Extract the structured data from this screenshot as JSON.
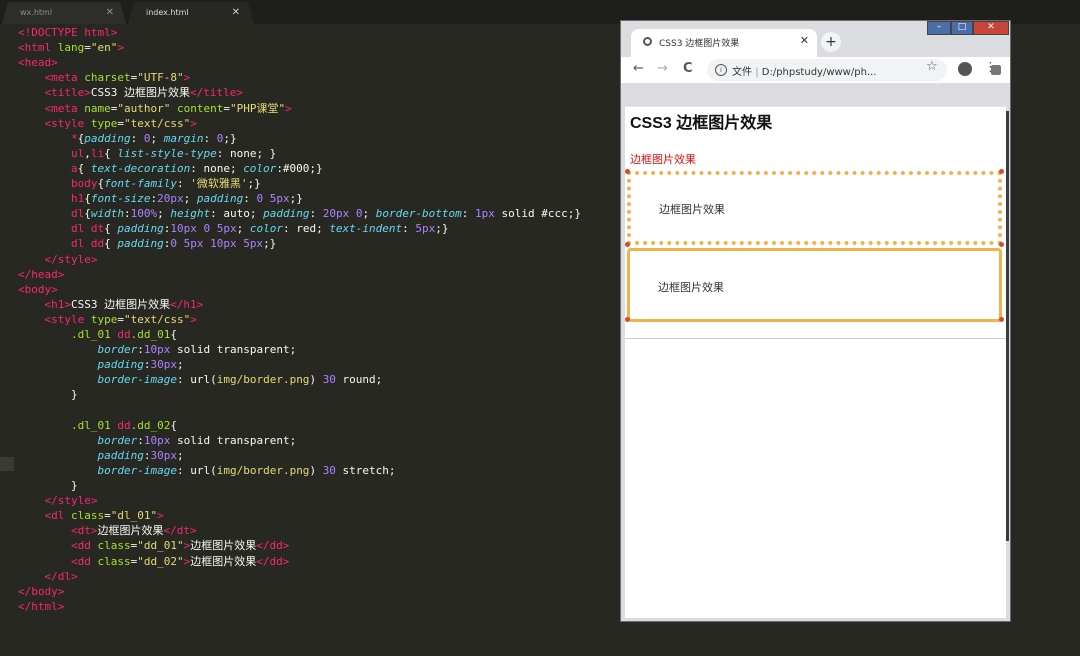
{
  "editor": {
    "tabs": [
      {
        "label": "wx.html",
        "close": "✕"
      },
      {
        "label": "index.html",
        "close": "✕"
      }
    ],
    "lines": [
      [
        "t:<!DOCTYPE html>"
      ],
      [
        "t:<html ",
        "a:lang",
        "w:=",
        "s:\"en\"",
        "t:>"
      ],
      [
        "t:<head>"
      ],
      [
        "w:    ",
        "t:<meta ",
        "a:charset",
        "w:=",
        "s:\"UTF-8\"",
        "t:>"
      ],
      [
        "w:    ",
        "t:<title>",
        "w:CSS3 边框图片效果",
        "t:</title>"
      ],
      [
        "w:    ",
        "t:<meta ",
        "a:name",
        "w:=",
        "s:\"author\" ",
        "a:content",
        "w:=",
        "s:\"PHP课堂\"",
        "t:>"
      ],
      [
        "w:    ",
        "t:<style ",
        "a:type",
        "w:=",
        "s:\"text/css\"",
        "t:>"
      ],
      [
        "w:        ",
        "t:*",
        "w:{",
        "p:padding",
        "w:: ",
        "n:0",
        "w:; ",
        "p:margin",
        "w:: ",
        "n:0",
        "w:;}"
      ],
      [
        "w:        ",
        "t:ul",
        "w:,",
        "t:li",
        "w:{ ",
        "p:list-style-type",
        "w:: none; }"
      ],
      [
        "w:        ",
        "t:a",
        "w:{ ",
        "p:text-decoration",
        "w:: none; ",
        "p:color",
        "w::#000;}"
      ],
      [
        "w:        ",
        "t:body",
        "w:{",
        "p:font-family",
        "w:: ",
        "s:'微软雅黑'",
        "w:;}"
      ],
      [
        "w:        ",
        "t:h1",
        "w:{",
        "p:font-size",
        "w::",
        "n:20px",
        "w:; ",
        "p:padding",
        "w:: ",
        "n:0 5px",
        "w:;}"
      ],
      [
        "w:        ",
        "t:dl",
        "w:{",
        "p:width",
        "w::",
        "n:100%",
        "w:; ",
        "p:height",
        "w:: auto; ",
        "p:padding",
        "w:: ",
        "n:20px 0",
        "w:; ",
        "p:border-bottom",
        "w:: ",
        "n:1px",
        "w: solid #ccc;}"
      ],
      [
        "w:        ",
        "t:dl dt",
        "w:{ ",
        "p:padding",
        "w::",
        "n:10px 0 5px",
        "w:; ",
        "p:color",
        "w:: red; ",
        "p:text-indent",
        "w:: ",
        "n:5px",
        "w:;}"
      ],
      [
        "w:        ",
        "t:dl dd",
        "w:{ ",
        "p:padding",
        "w::",
        "n:0 5px 10px 5px",
        "w:;}"
      ],
      [
        "w:    ",
        "t:</style>"
      ],
      [
        "t:</head>"
      ],
      [
        "t:<body>"
      ],
      [
        "w:    ",
        "t:<h1>",
        "w:CSS3 边框图片效果",
        "t:</h1>"
      ],
      [
        "w:    ",
        "t:<style ",
        "a:type",
        "w:=",
        "s:\"text/css\"",
        "t:>"
      ],
      [
        "w:        ",
        "a:.dl_01 ",
        "t:dd",
        "a:.dd_01",
        "w:{"
      ],
      [
        "w:            ",
        "p:border",
        "w::",
        "n:10px",
        "w: solid transparent;"
      ],
      [
        "w:            ",
        "p:padding",
        "w::",
        "n:30px",
        "w:;"
      ],
      [
        "w:            ",
        "p:border-image",
        "w:: url(",
        "s:img/border.png",
        "w:) ",
        "n:30",
        "w: round;"
      ],
      [
        "w:        }"
      ],
      [
        "w: "
      ],
      [
        "w:        ",
        "a:.dl_01 ",
        "t:dd",
        "a:.dd_02",
        "w:{"
      ],
      [
        "w:            ",
        "p:border",
        "w::",
        "n:10px",
        "w: solid transparent;"
      ],
      [
        "w:            ",
        "p:padding",
        "w::",
        "n:30px",
        "w:;"
      ],
      [
        "w:            ",
        "p:border-image",
        "w:: url(",
        "s:img/border.png",
        "w:) ",
        "n:30",
        "w: stretch;"
      ],
      [
        "w:        }"
      ],
      [
        "w:    ",
        "t:</style>"
      ],
      [
        "w:    ",
        "t:<dl ",
        "a:class",
        "w:=",
        "s:\"dl_01\"",
        "t:>"
      ],
      [
        "w:        ",
        "t:<dt>",
        "w:边框图片效果",
        "t:</dt>"
      ],
      [
        "w:        ",
        "t:<dd ",
        "a:class",
        "w:=",
        "s:\"dd_01\"",
        "t:>",
        "w:边框图片效果",
        "t:</dd>"
      ],
      [
        "w:        ",
        "t:<dd ",
        "a:class",
        "w:=",
        "s:\"dd_02\"",
        "t:>",
        "w:边框图片效果",
        "t:</dd>"
      ],
      [
        "w:    ",
        "t:</dl>"
      ],
      [
        "t:</body>"
      ],
      [
        "t:</html>"
      ]
    ]
  },
  "browser": {
    "window_controls": {
      "min": "–",
      "max": "□",
      "close": "✕"
    },
    "tab_title": "CSS3 边框图片效果",
    "tab_close": "✕",
    "new_tab": "+",
    "toolbar": {
      "back": "←",
      "forward": "→",
      "reload": "C",
      "info": "i",
      "scheme_label": "文件",
      "separator": "|",
      "url": "D:/phpstudy/www/ph...",
      "star": "☆",
      "menu": "⋮"
    },
    "page": {
      "h1": "CSS3 边框图片效果",
      "dt": "边框图片效果",
      "dd1": "边框图片效果",
      "dd2": "边框图片效果"
    }
  },
  "colors": {
    "editor_bg": "#272822",
    "tag": "#f92672",
    "attr": "#a6e22e",
    "string": "#e6db74",
    "property": "#66d9ef",
    "number": "#ae81ff",
    "border_image": "#f0b34a",
    "dt_red": "#dd1111"
  }
}
